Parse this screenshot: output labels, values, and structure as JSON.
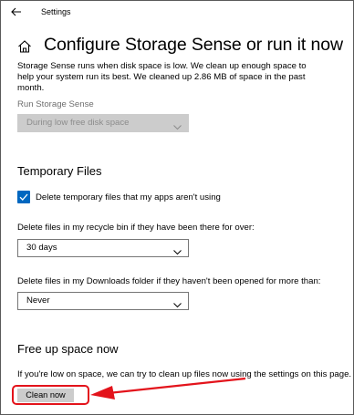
{
  "window": {
    "title": "Settings"
  },
  "page": {
    "title": "Configure Storage Sense or run it now",
    "description": "Storage Sense runs when disk space is low. We clean up enough space to help your system run its best. We cleaned up 2.86 MB of space in the past month."
  },
  "run_storage_sense": {
    "label": "Run Storage Sense",
    "selected": "During low free disk space",
    "disabled": true
  },
  "temporary_files": {
    "heading": "Temporary Files",
    "delete_temp_checkbox": {
      "label": "Delete temporary files that my apps aren't using",
      "checked": true
    },
    "recycle_bin": {
      "label": "Delete files in my recycle bin if they have been there for over:",
      "selected": "30 days"
    },
    "downloads": {
      "label": "Delete files in my Downloads folder if they haven't been opened for more than:",
      "selected": "Never"
    }
  },
  "free_up_space": {
    "heading": "Free up space now",
    "description": "If you're low on space, we can try to clean up files now using the settings on this page.",
    "button_label": "Clean now"
  },
  "icons": {
    "back": "back-arrow-icon",
    "home": "home-icon",
    "chevron": "chevron-down-icon",
    "checkmark": "checkmark-icon"
  },
  "colors": {
    "accent": "#0067c0",
    "annotation": "#e3131b",
    "disabled_fill": "#cccccc"
  }
}
